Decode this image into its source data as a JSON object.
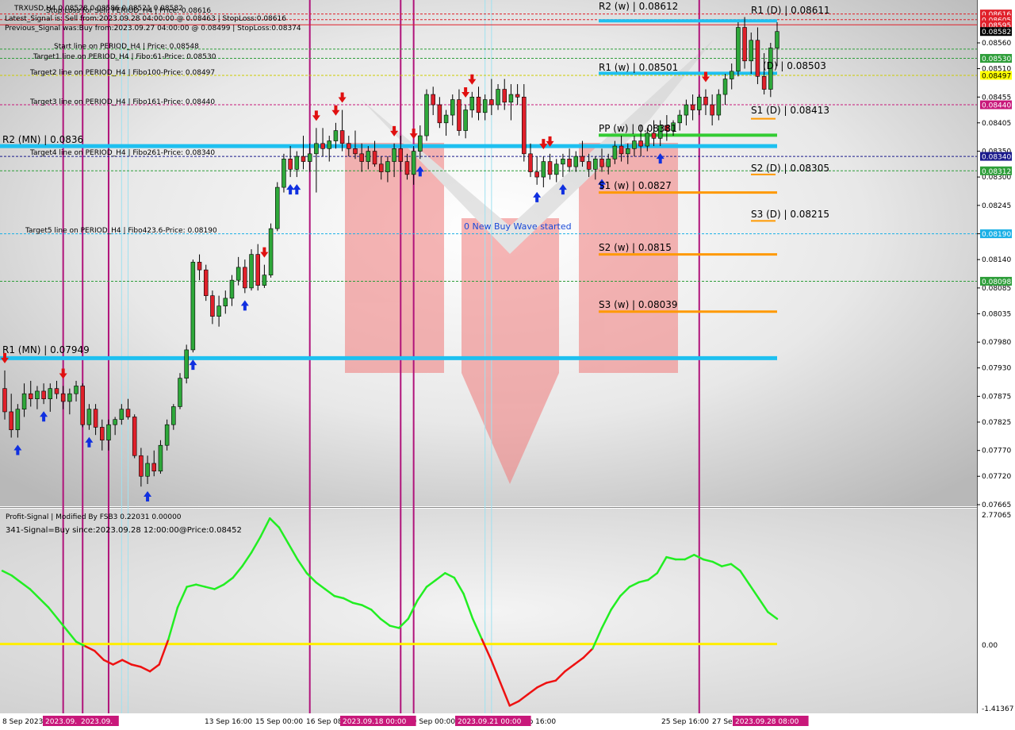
{
  "header": {
    "symbol_line": "TRXUSD,H4  0.08528 0.08586 0.08521 0.08582",
    "stop_loss_line": "Stop Loss for Sell: PERIOD_H4  | Price: 0.08616",
    "latest_signal": "Latest_Signal is: Sell from:2023.09.28 04:00:00 @ 0.08463 | StopLoss:0.08616",
    "previous_signal": "Previous_Signal was:Buy from:2023.09.27 04:00:00 @ 0.08499 | StopLoss:0.08374",
    "start_line": "Start line on PERIOD_H4 | Price: 0.08548",
    "target1": "Target1 line on PERIOD_H4 | Fibo:61-Price: 0.08530",
    "target2": "Target2 line on PERIOD_H4 | Fibo100-Price: 0.08497",
    "target3": "Target3 line on PERIOD_H4 | Fibo161-Price: 0.08440",
    "target4": "Target4 line on PERIOD_H4 | Fibo261-Price: 0.08340",
    "target5": "Target5 line on PERIOD_H4 | Fibo423.6-Price: 0.08190",
    "wave_label": "0 New Buy Wave started"
  },
  "indicator": {
    "title": "Profit-Signal | Modified By FSB3 0.22031 0.00000",
    "signal": "341-Signal=Buy since:2023.09.28 12:00:00@Price:0.08452",
    "axis_top": "2.77065",
    "axis_zero": "0.00",
    "axis_bottom": "-1.41367"
  },
  "price_axis": [
    "0.08560",
    "0.08510",
    "0.08455",
    "0.08405",
    "0.08350",
    "0.08300",
    "0.08245",
    "0.08190",
    "0.08140",
    "0.08085",
    "0.08035",
    "0.07980",
    "0.07930",
    "0.07875",
    "0.07825",
    "0.07770",
    "0.07720",
    "0.07665"
  ],
  "price_tags": [
    {
      "text": "0.08616",
      "bg": "#e0202a",
      "fg": "#ffffff"
    },
    {
      "text": "0.08605",
      "bg": "#e0202a",
      "fg": "#ffffff"
    },
    {
      "text": "0.08595",
      "bg": "#e0202a",
      "fg": "#ffffff"
    },
    {
      "text": "0.08582",
      "bg": "#000000",
      "fg": "#ffffff"
    },
    {
      "text": "0.08530",
      "bg": "#2e9e3a",
      "fg": "#ffffff"
    },
    {
      "text": "0.08497",
      "bg": "#ffff00",
      "fg": "#000000"
    },
    {
      "text": "0.08440",
      "bg": "#c8187a",
      "fg": "#ffffff"
    },
    {
      "text": "0.08340",
      "bg": "#1a1a8c",
      "fg": "#ffffff"
    },
    {
      "text": "0.08312",
      "bg": "#2e9e3a",
      "fg": "#ffffff"
    },
    {
      "text": "0.08190",
      "bg": "#1ab0e6",
      "fg": "#ffffff"
    },
    {
      "text": "0.08098",
      "bg": "#2e9e3a",
      "fg": "#ffffff"
    }
  ],
  "time_axis": [
    "8 Sep 2023",
    "13 Sep 16:00",
    "15 Sep 00:00",
    "16 Sep 08:00",
    "19 Sep 00:00",
    "21 Sep 16:00",
    "25 Sep 16:00",
    "27 Sep 08:00"
  ],
  "time_tags": [
    "2023.09.",
    "2023.09.",
    "2023.09.18 00:00",
    "2023.09.21 00:00",
    "2023.09.28 08:00"
  ],
  "pivot_labels": {
    "r2_mn": "R2 (MN) | 0.0836",
    "r1_mn": "R1 (MN) | 0.07949",
    "r2_w": "R2 (w) | 0.08612",
    "r1_w": "R1 (w) | 0.08501",
    "pp_w": "PP (w) | 0.08381",
    "s1_w": "S1 (w) | 0.0827",
    "s2_w": "S2 (w) | 0.0815",
    "s3_w": "S3 (w) | 0.08039",
    "r1_d": "R1 (D) | 0.08611",
    "pp_d": "(D) | 0.08503",
    "s1_d": "S1 (D) | 0.08413",
    "s2_d": "S2 (D) | 0.08305",
    "s3_d": "S3 (D) | 0.08215"
  },
  "colors": {
    "bull": "#2ea83a",
    "bear": "#e0202a",
    "pivot_mn": "#1ec0f0",
    "pivot_w_r": "#1ec0f0",
    "pivot_w_pp": "#33cc33",
    "pivot_w_s": "#ff9900",
    "vline": "#b0137a",
    "signal_green": "#22ee22",
    "signal_red": "#ee1111",
    "zero_line": "#ffee00"
  },
  "chart_data": {
    "type": "candlestick",
    "symbol": "TRXUSD",
    "timeframe": "H4",
    "ylim": [
      0.07665,
      0.0864
    ],
    "candles": [
      [
        0.0789,
        0.07925,
        0.0783,
        0.07845
      ],
      [
        0.07845,
        0.0788,
        0.07795,
        0.0781
      ],
      [
        0.0781,
        0.0786,
        0.07795,
        0.0785
      ],
      [
        0.0785,
        0.079,
        0.07835,
        0.0788
      ],
      [
        0.0788,
        0.07905,
        0.07855,
        0.0787
      ],
      [
        0.0787,
        0.07895,
        0.0785,
        0.07885
      ],
      [
        0.07885,
        0.079,
        0.0786,
        0.0787
      ],
      [
        0.0787,
        0.079,
        0.07845,
        0.0789
      ],
      [
        0.0789,
        0.07905,
        0.0787,
        0.0788
      ],
      [
        0.0788,
        0.07895,
        0.0785,
        0.07865
      ],
      [
        0.07865,
        0.0789,
        0.0784,
        0.0788
      ],
      [
        0.0788,
        0.07905,
        0.07865,
        0.07895
      ],
      [
        0.07895,
        0.079,
        0.07815,
        0.0782
      ],
      [
        0.0782,
        0.0786,
        0.0781,
        0.0785
      ],
      [
        0.0785,
        0.0786,
        0.078,
        0.07815
      ],
      [
        0.07815,
        0.0783,
        0.0777,
        0.0779
      ],
      [
        0.0779,
        0.0783,
        0.0777,
        0.0782
      ],
      [
        0.0782,
        0.07835,
        0.078,
        0.0783
      ],
      [
        0.0783,
        0.0786,
        0.0782,
        0.0785
      ],
      [
        0.0785,
        0.0787,
        0.0783,
        0.07835
      ],
      [
        0.07835,
        0.0784,
        0.07755,
        0.0776
      ],
      [
        0.0776,
        0.07775,
        0.077,
        0.0772
      ],
      [
        0.0772,
        0.0776,
        0.07705,
        0.07745
      ],
      [
        0.07745,
        0.0777,
        0.0772,
        0.0773
      ],
      [
        0.0773,
        0.0779,
        0.07725,
        0.0778
      ],
      [
        0.0778,
        0.0783,
        0.0777,
        0.0782
      ],
      [
        0.0782,
        0.0786,
        0.0781,
        0.07855
      ],
      [
        0.07855,
        0.0792,
        0.0785,
        0.0791
      ],
      [
        0.0791,
        0.07975,
        0.079,
        0.07965
      ],
      [
        0.07965,
        0.0814,
        0.0796,
        0.08135
      ],
      [
        0.08135,
        0.0815,
        0.081,
        0.0812
      ],
      [
        0.0812,
        0.0813,
        0.0806,
        0.0807
      ],
      [
        0.0807,
        0.0808,
        0.08015,
        0.0803
      ],
      [
        0.0803,
        0.0807,
        0.0801,
        0.0805
      ],
      [
        0.0805,
        0.0808,
        0.08035,
        0.08065
      ],
      [
        0.08065,
        0.0811,
        0.0805,
        0.081
      ],
      [
        0.081,
        0.08145,
        0.0809,
        0.08125
      ],
      [
        0.08125,
        0.0814,
        0.08075,
        0.08085
      ],
      [
        0.08085,
        0.0816,
        0.0808,
        0.0815
      ],
      [
        0.0815,
        0.0817,
        0.0808,
        0.0809
      ],
      [
        0.0809,
        0.0813,
        0.08085,
        0.0811
      ],
      [
        0.0811,
        0.0821,
        0.08105,
        0.082
      ],
      [
        0.082,
        0.0829,
        0.08195,
        0.0828
      ],
      [
        0.0828,
        0.08345,
        0.0827,
        0.08335
      ],
      [
        0.08335,
        0.0836,
        0.083,
        0.08315
      ],
      [
        0.08315,
        0.0835,
        0.083,
        0.0834
      ],
      [
        0.0834,
        0.0838,
        0.08315,
        0.0833
      ],
      [
        0.0833,
        0.08365,
        0.0831,
        0.08345
      ],
      [
        0.08345,
        0.08395,
        0.0827,
        0.08365
      ],
      [
        0.08365,
        0.08395,
        0.0834,
        0.08355
      ],
      [
        0.08355,
        0.0838,
        0.0833,
        0.0837
      ],
      [
        0.0837,
        0.08405,
        0.08355,
        0.0839
      ],
      [
        0.0839,
        0.0843,
        0.0835,
        0.08365
      ],
      [
        0.08365,
        0.0838,
        0.0834,
        0.08355
      ],
      [
        0.08355,
        0.0839,
        0.08335,
        0.08345
      ],
      [
        0.08345,
        0.08365,
        0.0831,
        0.0833
      ],
      [
        0.0833,
        0.0836,
        0.08315,
        0.0835
      ],
      [
        0.0835,
        0.0837,
        0.0832,
        0.08325
      ],
      [
        0.08325,
        0.0834,
        0.08295,
        0.0831
      ],
      [
        0.0831,
        0.0834,
        0.0829,
        0.0833
      ],
      [
        0.0833,
        0.08365,
        0.083,
        0.08355
      ],
      [
        0.08355,
        0.0838,
        0.0831,
        0.0833
      ],
      [
        0.0833,
        0.08345,
        0.08295,
        0.08305
      ],
      [
        0.08305,
        0.0836,
        0.08285,
        0.0835
      ],
      [
        0.0835,
        0.084,
        0.08335,
        0.0838
      ],
      [
        0.0838,
        0.0847,
        0.0837,
        0.0846
      ],
      [
        0.0846,
        0.08475,
        0.0842,
        0.0844
      ],
      [
        0.0844,
        0.08455,
        0.08395,
        0.08405
      ],
      [
        0.08405,
        0.0843,
        0.0838,
        0.0842
      ],
      [
        0.0842,
        0.0846,
        0.084,
        0.0845
      ],
      [
        0.0845,
        0.0847,
        0.0838,
        0.0839
      ],
      [
        0.0839,
        0.0844,
        0.08375,
        0.0843
      ],
      [
        0.0843,
        0.08465,
        0.08415,
        0.08455
      ],
      [
        0.08455,
        0.08475,
        0.0841,
        0.08425
      ],
      [
        0.08425,
        0.0846,
        0.0841,
        0.0845
      ],
      [
        0.0845,
        0.0849,
        0.0842,
        0.0844
      ],
      [
        0.0844,
        0.0848,
        0.0843,
        0.0847
      ],
      [
        0.0847,
        0.0849,
        0.0843,
        0.08445
      ],
      [
        0.08445,
        0.0848,
        0.0841,
        0.0846
      ],
      [
        0.0846,
        0.0848,
        0.0844,
        0.08455
      ],
      [
        0.08455,
        0.0848,
        0.0833,
        0.08345
      ],
      [
        0.08345,
        0.08365,
        0.083,
        0.0831
      ],
      [
        0.0831,
        0.0834,
        0.08285,
        0.083
      ],
      [
        0.083,
        0.0834,
        0.0828,
        0.0833
      ],
      [
        0.0833,
        0.08345,
        0.08295,
        0.08305
      ],
      [
        0.08305,
        0.08335,
        0.0829,
        0.08325
      ],
      [
        0.08325,
        0.08345,
        0.083,
        0.08335
      ],
      [
        0.08335,
        0.08355,
        0.0831,
        0.0832
      ],
      [
        0.0832,
        0.0835,
        0.0831,
        0.0834
      ],
      [
        0.0834,
        0.0837,
        0.0832,
        0.0833
      ],
      [
        0.0833,
        0.08345,
        0.083,
        0.08315
      ],
      [
        0.08315,
        0.0834,
        0.08295,
        0.08335
      ],
      [
        0.08335,
        0.08355,
        0.0831,
        0.0832
      ],
      [
        0.0832,
        0.08345,
        0.08305,
        0.08335
      ],
      [
        0.08335,
        0.0837,
        0.08325,
        0.0836
      ],
      [
        0.0836,
        0.0838,
        0.0833,
        0.08345
      ],
      [
        0.08345,
        0.08365,
        0.08325,
        0.08355
      ],
      [
        0.08355,
        0.0838,
        0.0834,
        0.0837
      ],
      [
        0.0837,
        0.084,
        0.0834,
        0.0836
      ],
      [
        0.0836,
        0.08395,
        0.0835,
        0.08385
      ],
      [
        0.08385,
        0.0841,
        0.0836,
        0.08375
      ],
      [
        0.08375,
        0.0841,
        0.0836,
        0.084
      ],
      [
        0.084,
        0.0842,
        0.0837,
        0.0839
      ],
      [
        0.0839,
        0.0841,
        0.0838,
        0.08405
      ],
      [
        0.08405,
        0.0843,
        0.0839,
        0.0842
      ],
      [
        0.0842,
        0.0845,
        0.084,
        0.0844
      ],
      [
        0.0844,
        0.0846,
        0.0841,
        0.0843
      ],
      [
        0.0843,
        0.0846,
        0.0842,
        0.08455
      ],
      [
        0.08455,
        0.0847,
        0.0842,
        0.0844
      ],
      [
        0.0844,
        0.0846,
        0.084,
        0.0842
      ],
      [
        0.0842,
        0.0847,
        0.0841,
        0.0846
      ],
      [
        0.0846,
        0.085,
        0.0844,
        0.0849
      ],
      [
        0.0849,
        0.0852,
        0.0847,
        0.08505
      ],
      [
        0.08505,
        0.086,
        0.08495,
        0.0859
      ],
      [
        0.0859,
        0.0861,
        0.0851,
        0.08525
      ],
      [
        0.08525,
        0.0858,
        0.085,
        0.08565
      ],
      [
        0.08565,
        0.0859,
        0.0848,
        0.08495
      ],
      [
        0.08495,
        0.0854,
        0.0846,
        0.0847
      ],
      [
        0.0847,
        0.0856,
        0.08455,
        0.0855
      ],
      [
        0.0855,
        0.086,
        0.08515,
        0.08582
      ]
    ],
    "indicator": {
      "name": "Profit-Signal",
      "ylim": [
        -1.41367,
        2.77065
      ],
      "values": [
        1.6,
        1.5,
        1.35,
        1.2,
        1.0,
        0.8,
        0.55,
        0.3,
        0.05,
        -0.05,
        -0.15,
        -0.35,
        -0.45,
        -0.35,
        -0.45,
        -0.5,
        -0.6,
        -0.45,
        0.1,
        0.8,
        1.25,
        1.3,
        1.25,
        1.2,
        1.3,
        1.45,
        1.7,
        2.0,
        2.35,
        2.75,
        2.55,
        2.2,
        1.85,
        1.55,
        1.35,
        1.2,
        1.05,
        1.0,
        0.9,
        0.85,
        0.75,
        0.55,
        0.4,
        0.35,
        0.55,
        0.95,
        1.25,
        1.4,
        1.55,
        1.45,
        1.1,
        0.55,
        0.1,
        -0.35,
        -0.85,
        -1.35,
        -1.25,
        -1.1,
        -0.95,
        -0.85,
        -0.8,
        -0.6,
        -0.45,
        -0.3,
        -0.1,
        0.35,
        0.75,
        1.05,
        1.25,
        1.35,
        1.4,
        1.55,
        1.9,
        1.85,
        1.85,
        1.95,
        1.85,
        1.8,
        1.7,
        1.75,
        1.6,
        1.3,
        1.0,
        0.7,
        0.55
      ],
      "zero_line": 0
    },
    "buy_arrows": [
      2,
      6,
      13,
      22,
      29,
      37,
      44,
      45,
      64,
      82,
      86,
      92,
      101
    ],
    "sell_arrows": [
      0,
      9,
      40,
      48,
      51,
      52,
      60,
      63,
      71,
      72,
      83,
      84,
      108
    ],
    "vlines": [
      9,
      12,
      16,
      47,
      61,
      63,
      107
    ],
    "cyan_vlines": [
      18,
      19,
      74,
      75
    ]
  }
}
